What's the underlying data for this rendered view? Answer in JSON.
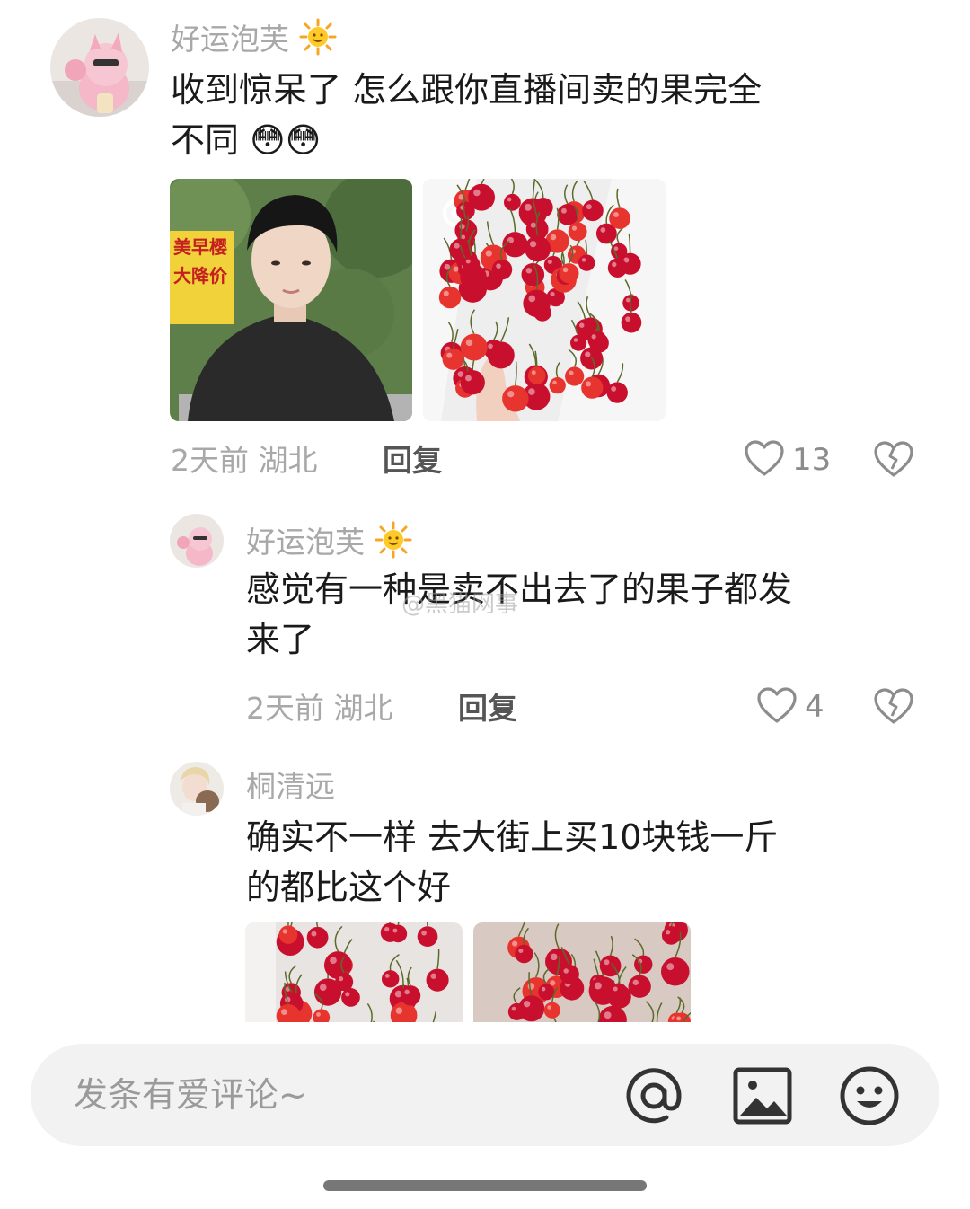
{
  "comments": [
    {
      "username": "好运泡芙",
      "username_emoji": "sun-emoji",
      "text_line1": "收到惊呆了 怎么跟你直播间卖的果完全",
      "text_line2": "不同 😳😳",
      "time": "2天前",
      "location": "湖北",
      "reply_label": "回复",
      "likes": "13",
      "image_sign_text_1": "美早樱",
      "image_sign_text_2": "大降价"
    },
    {
      "username": "好运泡芙",
      "username_emoji": "sun-emoji",
      "text_line1": "感觉有一种是卖不出去了的果子都发",
      "text_line2": "来了",
      "time": "2天前",
      "location": "湖北",
      "reply_label": "回复",
      "likes": "4"
    },
    {
      "username": "桐清远",
      "text_line1": "确实不一样 去大街上买10块钱一斤",
      "text_line2": "的都比这个好"
    }
  ],
  "watermark": "@黑猫网事",
  "input": {
    "placeholder": "发条有爱评论~"
  },
  "colors": {
    "meta_gray": "#a8a8a8",
    "pill_bg": "#f2f2f2",
    "cherry_red": "#c8102e"
  }
}
